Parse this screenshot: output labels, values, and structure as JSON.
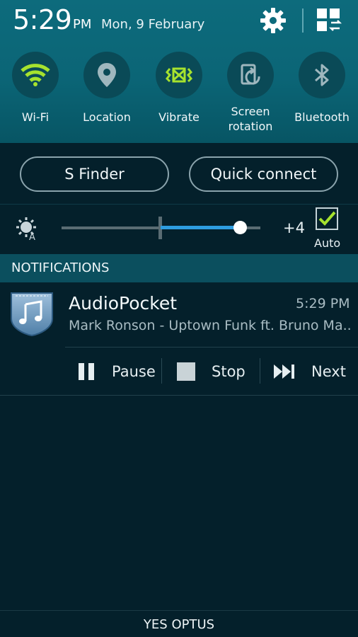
{
  "status": {
    "time": "5:29",
    "ampm": "PM",
    "date": "Mon, 9 February"
  },
  "toggles": [
    {
      "label": "Wi-Fi",
      "icon": "wifi-icon",
      "active": true
    },
    {
      "label": "Location",
      "icon": "location-icon",
      "active": false
    },
    {
      "label": "Vibrate",
      "icon": "vibrate-icon",
      "active": true
    },
    {
      "label": "Screen rotation",
      "line1": "Screen",
      "line2": "rotation",
      "icon": "screen-rotation-icon",
      "active": false
    },
    {
      "label": "Bluetooth",
      "icon": "bluetooth-icon",
      "active": false
    }
  ],
  "buttons": {
    "s_finder": "S Finder",
    "quick_connect": "Quick connect"
  },
  "brightness": {
    "value_label": "+4",
    "level_fraction": 0.89,
    "auto_label": "Auto",
    "auto_checked": true
  },
  "notifications": {
    "header": "NOTIFICATIONS",
    "items": [
      {
        "app": "AudioPocket",
        "time": "5:29 PM",
        "text": "Mark Ronson - Uptown Funk ft. Bruno Ma..",
        "actions": {
          "pause": "Pause",
          "stop": "Stop",
          "next": "Next"
        }
      }
    ]
  },
  "carrier": "YES OPTUS",
  "colors": {
    "accent_active": "#a6e22e",
    "panel": "#0b6576",
    "background": "#04202b",
    "slider": "#2e9de0"
  }
}
